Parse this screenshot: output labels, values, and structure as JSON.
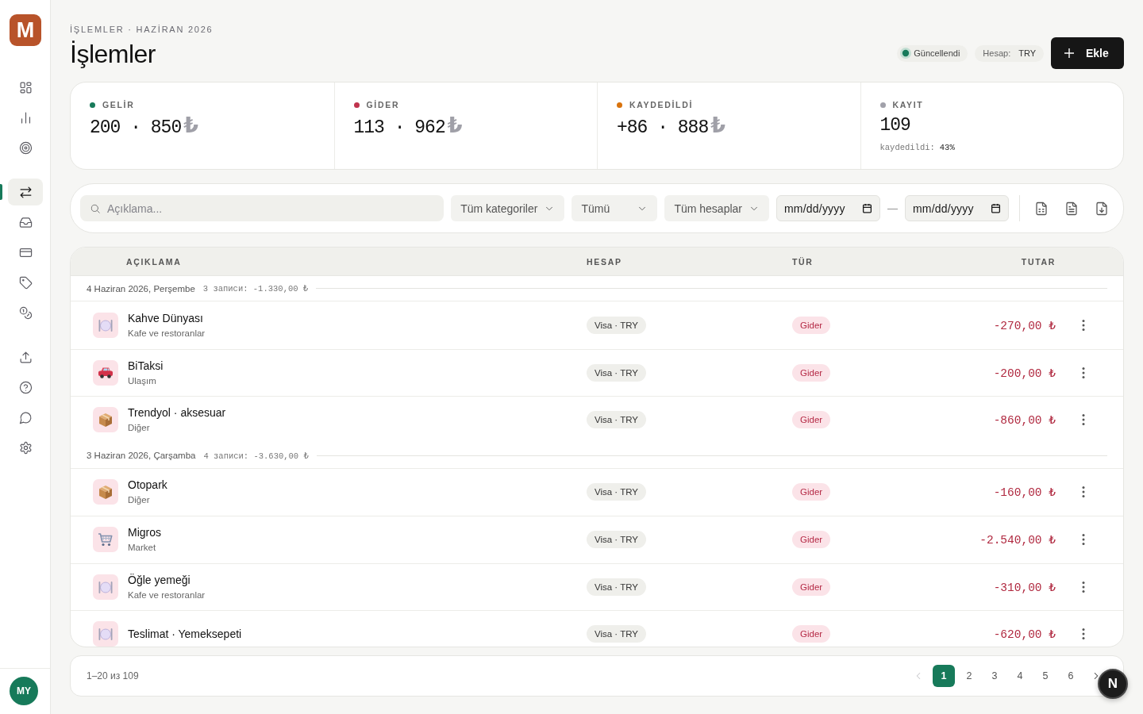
{
  "sidebar": {
    "logo": "M",
    "groups": [
      {
        "items": [
          {
            "kind": "grid",
            "selected": false
          },
          {
            "kind": "chart",
            "selected": false
          },
          {
            "kind": "target",
            "selected": false
          }
        ]
      },
      {
        "items": [
          {
            "kind": "transfer",
            "selected": true
          },
          {
            "kind": "inbox",
            "selected": false
          },
          {
            "kind": "card",
            "selected": false
          },
          {
            "kind": "tag",
            "selected": false
          },
          {
            "kind": "coins",
            "selected": false
          }
        ]
      },
      {
        "items": [
          {
            "kind": "upload",
            "selected": false
          },
          {
            "kind": "help",
            "selected": false
          },
          {
            "kind": "chat",
            "selected": false
          },
          {
            "kind": "settings",
            "selected": false
          }
        ]
      }
    ],
    "avatar": "MY"
  },
  "header": {
    "breadcrumb": "İŞLEMLER · HAZİRAN 2026",
    "title": "İşlemler",
    "status": "Güncellendi",
    "account": {
      "label": "Hesap:",
      "value": "TRY"
    },
    "add_button": "Ekle"
  },
  "stats": [
    {
      "label": "GELİR",
      "color": "#177a5a",
      "value": "200 · 850",
      "currency": "₺"
    },
    {
      "label": "GİDER",
      "color": "#c0334d",
      "value": "113 · 962",
      "currency": "₺"
    },
    {
      "label": "KAYDEDİLDİ",
      "color": "#d9730d",
      "value": "+86 · 888",
      "currency": "₺"
    },
    {
      "label": "KAYIT",
      "color": "#a1a1aa",
      "value": "109",
      "note": {
        "label": "kaydedildi:",
        "value": "43%"
      }
    }
  ],
  "filters": {
    "search": {
      "placeholder": "Açıklama..."
    },
    "selects": [
      "Tüm kategoriler",
      "Tümü",
      "Tüm hesaplar"
    ],
    "date_from": {
      "placeholder": "mm/dd/yyyy"
    },
    "date_separator": "—",
    "date_to": {
      "placeholder": "mm/dd/yyyy"
    },
    "exports": [
      {
        "kind": "spreadsheet"
      },
      {
        "kind": "document"
      },
      {
        "kind": "download"
      }
    ]
  },
  "table": {
    "columns": [
      "AÇIKLAMA",
      "HESAP",
      "TÜR",
      "TUTAR"
    ],
    "groups": [
      {
        "date": "4 Haziran 2026, Perşembe",
        "summary": "3 записи: -1.330,00 ₺",
        "rows": [
          {
            "kind": "dining",
            "title": "Kahve Dünyası",
            "category": "Kafe ve restoranlar",
            "account": "Visa · TRY",
            "type": "Gider",
            "amount": "-270,00 ₺"
          },
          {
            "kind": "transport",
            "title": "BiTaksi",
            "category": "Ulaşım",
            "account": "Visa · TRY",
            "type": "Gider",
            "amount": "-200,00 ₺"
          },
          {
            "kind": "parcel",
            "title": "Trendyol · aksesuar",
            "category": "Diğer",
            "account": "Visa · TRY",
            "type": "Gider",
            "amount": "-860,00 ₺"
          }
        ]
      },
      {
        "date": "3 Haziran 2026, Çarşamba",
        "summary": "4 записи: -3.630,00 ₺",
        "rows": [
          {
            "kind": "parcel",
            "title": "Otopark",
            "category": "Diğer",
            "account": "Visa · TRY",
            "type": "Gider",
            "amount": "-160,00 ₺"
          },
          {
            "kind": "grocery",
            "title": "Migros",
            "category": "Market",
            "account": "Visa · TRY",
            "type": "Gider",
            "amount": "-2.540,00 ₺"
          },
          {
            "kind": "dining",
            "title": "Öğle yemeği",
            "category": "Kafe ve restoranlar",
            "account": "Visa · TRY",
            "type": "Gider",
            "amount": "-310,00 ₺"
          },
          {
            "kind": "dining",
            "title": "Teslimat · Yemeksepeti",
            "account": "Visa · TRY",
            "type": "Gider",
            "amount": "-620,00 ₺"
          }
        ]
      }
    ]
  },
  "pagination": {
    "range": "1–20 из 109",
    "previous": {
      "disabled": true
    },
    "pages": [
      {
        "label": "1",
        "selected": true
      },
      {
        "label": "2",
        "selected": false
      },
      {
        "label": "3",
        "selected": false
      },
      {
        "label": "4",
        "selected": false
      },
      {
        "label": "5",
        "selected": false
      },
      {
        "label": "6",
        "selected": false
      }
    ],
    "next": {
      "disabled": false
    }
  },
  "dev_badge": "N"
}
